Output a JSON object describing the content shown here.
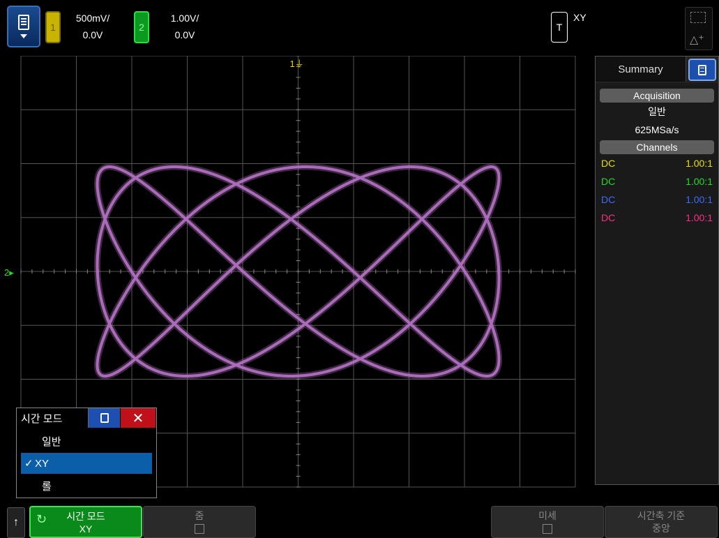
{
  "top_bar": {
    "channel1": {
      "number": "1",
      "scale": "500mV/",
      "offset": "0.0V",
      "color": "#c8b400"
    },
    "channel2": {
      "number": "2",
      "scale": "1.00V/",
      "offset": "0.0V",
      "color": "#0b9a1f"
    },
    "trigger": {
      "label": "T",
      "mode": "XY"
    }
  },
  "graticule": {
    "ch1_marker": "1",
    "ch2_marker": "2",
    "trace_color": "#b070c0",
    "figure": "lissajous"
  },
  "sidebar": {
    "tab_label": "Summary",
    "acquisition_header": "Acquisition",
    "acquisition_mode": "일반",
    "sample_rate": "625MSa/s",
    "channels_header": "Channels",
    "channels": [
      {
        "coupling": "DC",
        "probe": "1.00:1",
        "color": "#e8e000"
      },
      {
        "coupling": "DC",
        "probe": "1.00:1",
        "color": "#22dd22"
      },
      {
        "coupling": "DC",
        "probe": "1.00:1",
        "color": "#3a6cff"
      },
      {
        "coupling": "DC",
        "probe": "1.00:1",
        "color": "#ff2a8a"
      }
    ]
  },
  "popup": {
    "title": "시간 모드",
    "close_glyph": "✕",
    "items": [
      {
        "label": "일반",
        "selected": false
      },
      {
        "label": "XY",
        "selected": true
      },
      {
        "label": "롤",
        "selected": false
      }
    ],
    "check_glyph": "✓"
  },
  "softkeys": {
    "back_glyph": "↑",
    "time_mode": {
      "title": "시간 모드",
      "value": "XY"
    },
    "zoom": {
      "title": "줌"
    },
    "fine": {
      "title": "미세"
    },
    "time_ref": {
      "title": "시간축 기준",
      "value": "중앙"
    }
  }
}
